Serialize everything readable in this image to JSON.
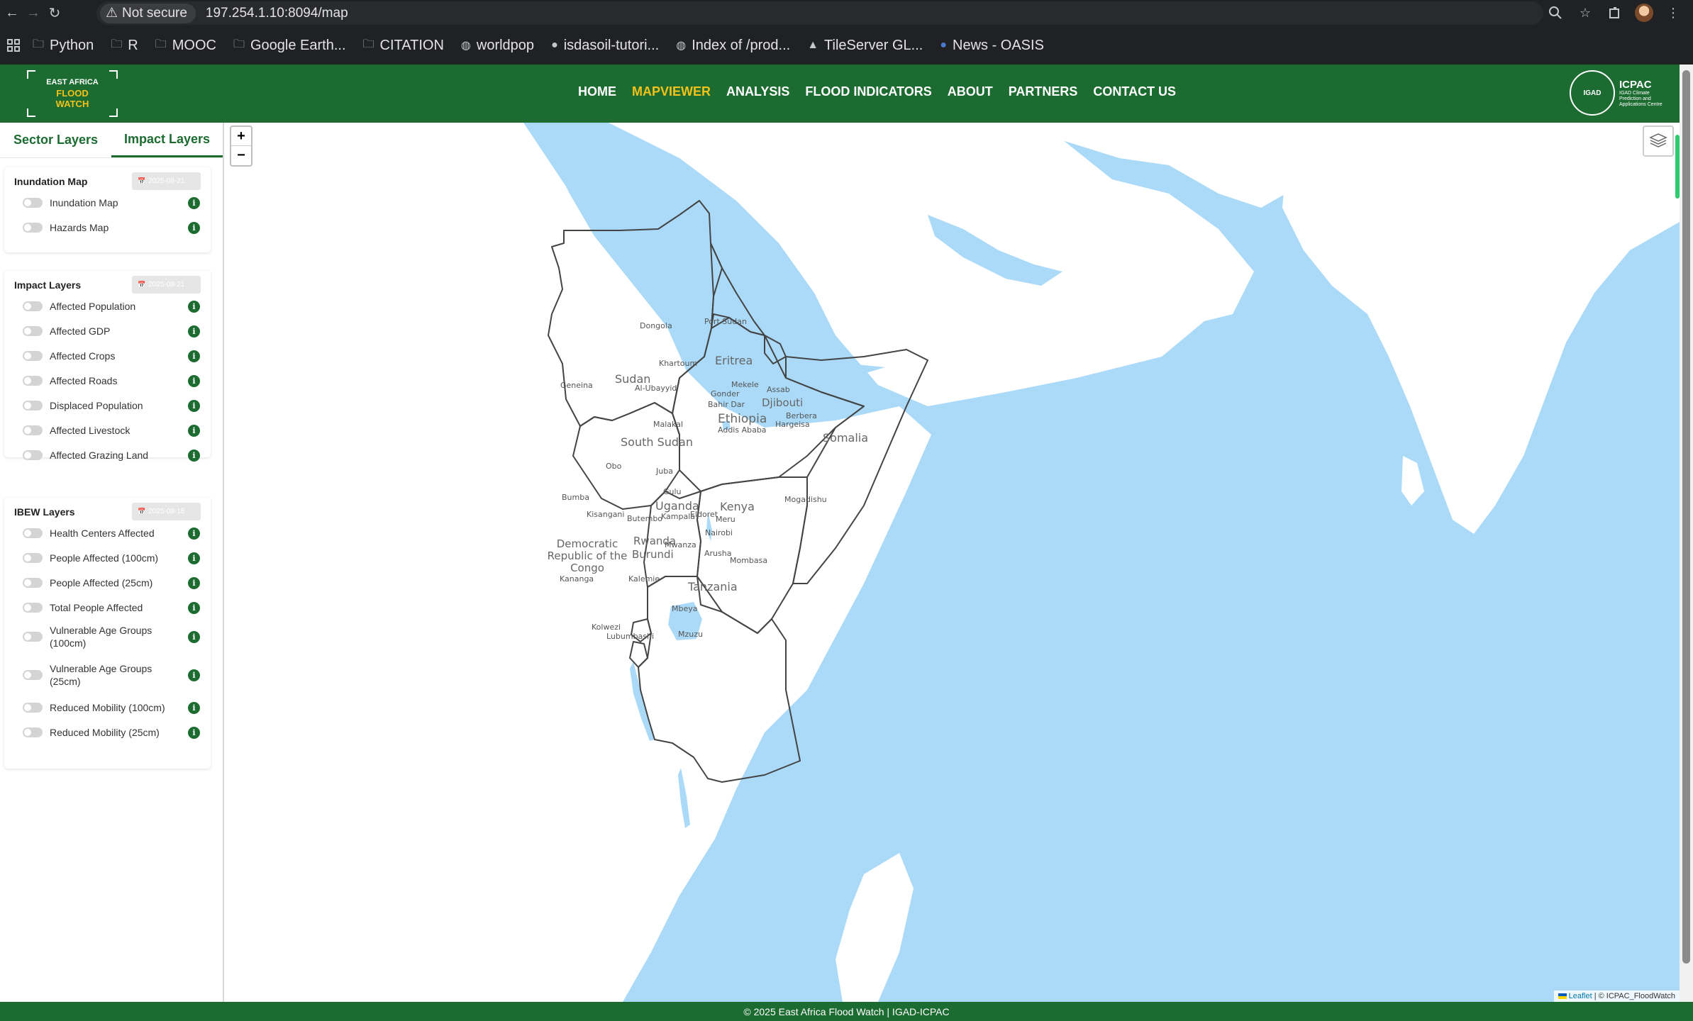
{
  "browser": {
    "security_label": "Not secure",
    "url": "197.254.1.10:8094/map",
    "bookmarks": [
      "Python",
      "R",
      "MOOC",
      "Google Earth...",
      "CITATION",
      "worldpop",
      "isdasoil-tutori...",
      "Index of /prod...",
      "TileServer GL...",
      "News - OASIS"
    ]
  },
  "header": {
    "logo_line1": "EAST AFRICA",
    "logo_line2": "FLOOD",
    "logo_line3": "WATCH",
    "nav": [
      "HOME",
      "MAPVIEWER",
      "ANALYSIS",
      "FLOOD INDICATORS",
      "ABOUT",
      "PARTNERS",
      "CONTACT US"
    ],
    "active_nav": "MAPVIEWER",
    "partner_badge": "IGAD",
    "partner_name": "ICPAC",
    "partner_tagline": "IGAD Climate Prediction and Applications Centre"
  },
  "sidebar": {
    "tabs": [
      "Sector Layers",
      "Impact Layers"
    ],
    "active_tab": "Impact Layers",
    "sections": [
      {
        "title": "Inundation Map",
        "date": "2025-08-21",
        "items": [
          "Inundation Map",
          "Hazards Map"
        ]
      },
      {
        "title": "Impact Layers",
        "date": "2025-08-21",
        "items": [
          "Affected Population",
          "Affected GDP",
          "Affected Crops",
          "Affected Roads",
          "Displaced Population",
          "Affected Livestock",
          "Affected Grazing Land"
        ]
      },
      {
        "title": "IBEW Layers",
        "date": "2025-08-18",
        "items": [
          "Health Centers Affected",
          "People Affected (100cm)",
          "People Affected (25cm)",
          "Total People Affected",
          "Vulnerable Age Groups (100cm)",
          "Vulnerable Age Groups (25cm)",
          "Reduced Mobility (100cm)",
          "Reduced Mobility (25cm)"
        ]
      }
    ],
    "info_glyph": "i"
  },
  "map": {
    "zoom_in": "+",
    "zoom_out": "−",
    "countries": [
      "Sudan",
      "Eritrea",
      "Djibouti",
      "Ethiopia",
      "Somalia",
      "South Sudan",
      "Kenya",
      "Uganda",
      "Rwanda",
      "Burundi",
      "Tanzania",
      "Democratic Republic of the Congo"
    ],
    "cities": [
      "Port Sudan",
      "Dongola",
      "Khartoum",
      "Geneina",
      "Al-Ubayyid",
      "Gonder",
      "Mekele",
      "Bahir Dar",
      "Assab",
      "Addis Ababa",
      "Berbera",
      "Hargeisa",
      "Malakal",
      "Juba",
      "Obo",
      "Gulu",
      "Bumba",
      "Kisangani",
      "Butembo",
      "Kampala",
      "Eldoret",
      "Meru",
      "Nairobi",
      "Mogadishu",
      "Mwanza",
      "Arusha",
      "Mombasa",
      "Kananga",
      "Kalemie",
      "Mbeya",
      "Kolwezi",
      "Lubumbashi",
      "Mzuzu"
    ],
    "attribution_leaflet": "Leaflet",
    "attribution_rest": " | © ICPAC_FloodWatch",
    "colors": {
      "water": "#aadaf7",
      "land": "#ffffff",
      "border": "#444444"
    }
  },
  "footer": {
    "text": "© 2025 East Africa Flood Watch | IGAD-ICPAC"
  },
  "theme": {
    "primary": "#1c6b30",
    "accent": "#f2c21a"
  }
}
